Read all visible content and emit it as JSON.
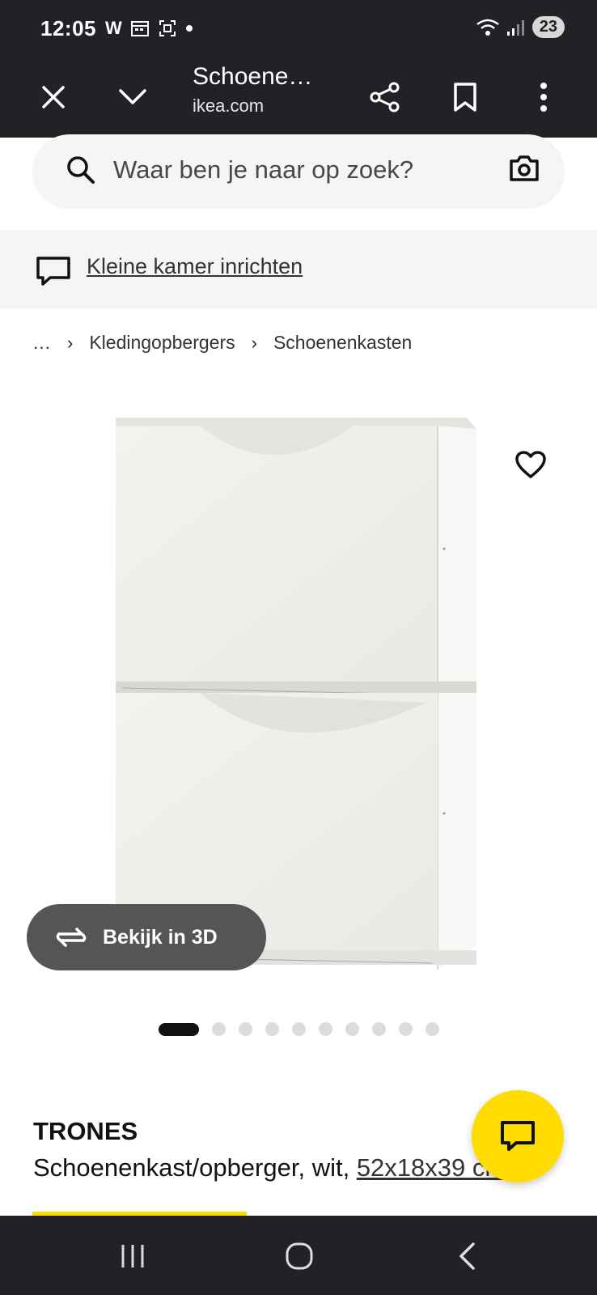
{
  "status_bar": {
    "time": "12:05",
    "battery": "23",
    "notif_letter": "W"
  },
  "toolbar": {
    "title": "Schoene…",
    "url": "ikea.com"
  },
  "search": {
    "placeholder": "Waar ben je naar op zoek?"
  },
  "banner": {
    "label": "Kleine kamer inrichten"
  },
  "breadcrumb": {
    "ellipsis": "…",
    "items": [
      "Kledingopbergers",
      "Schoenenkasten"
    ]
  },
  "viewer": {
    "label_3d": "Bekijk in 3D",
    "image_count": 10,
    "active_index": 0
  },
  "product": {
    "name": "TRONES",
    "description": "Schoenenkast/opberger, wit, ",
    "dimensions": "52x18x39 cm"
  },
  "colors": {
    "dark": "#212226",
    "ikea_yellow": "#ffdb00",
    "surface": "#f5f5f5"
  }
}
